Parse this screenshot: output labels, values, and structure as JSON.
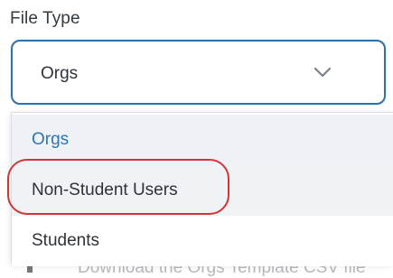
{
  "field": {
    "label": "File Type",
    "selected_value": "Orgs",
    "chevron_icon": "chevron-down-icon"
  },
  "dropdown": {
    "options": [
      {
        "label": "Orgs",
        "state": "selected"
      },
      {
        "label": "Non-Student Users",
        "state": "hovered"
      },
      {
        "label": "Students",
        "state": "default"
      }
    ]
  },
  "background_text": {
    "partial_line": "Download the Orgs Template CSV file"
  },
  "colors": {
    "accent": "#2f72aa",
    "selected_text": "#2e76b4",
    "annotation": "#d23535"
  }
}
